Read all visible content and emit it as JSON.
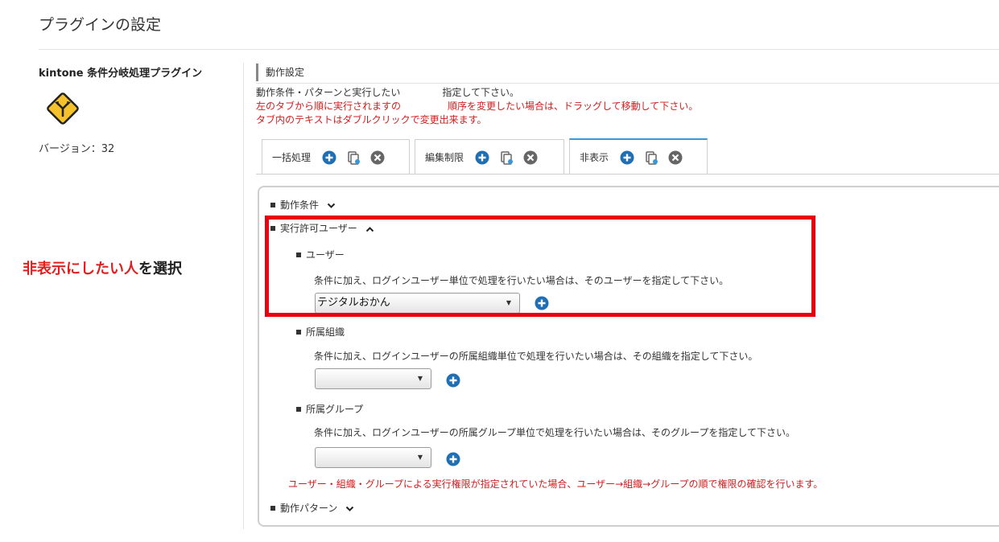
{
  "page": {
    "title": "プラグインの設定"
  },
  "plugin": {
    "name": "kintone 条件分岐処理プラグイン",
    "version": "バージョン：32",
    "icon": "diverge-road-sign-icon"
  },
  "annotation": {
    "highlight": "非表示にしたい人",
    "rest": "を選択"
  },
  "settings": {
    "heading": "動作設定",
    "desc_line1_a": "動作条件・パターンと実行したい",
    "desc_line1_b": "指定して下さい。",
    "desc_line2_a": "左のタブから順に実行されますの",
    "desc_line2_b": "順序を変更したい場合は、ドラッグして移動して下さい。",
    "desc_line3": "タブ内のテキストはダブルクリックで変更出来ます。"
  },
  "tabs": [
    {
      "label": "一括処理",
      "active": false
    },
    {
      "label": "編集制限",
      "active": false
    },
    {
      "label": "非表示",
      "active": true
    }
  ],
  "panel": {
    "condition": "動作条件",
    "permitted_users": "実行許可ユーザー",
    "user": {
      "heading": "ユーザー",
      "desc": "条件に加え、ログインユーザー単位で処理を行いたい場合は、そのユーザーを指定して下さい。",
      "selected": "テジタルおかん"
    },
    "org": {
      "heading": "所属組織",
      "desc": "条件に加え、ログインユーザーの所属組織単位で処理を行いたい場合は、その組織を指定して下さい。",
      "selected": ""
    },
    "group": {
      "heading": "所属グループ",
      "desc": "条件に加え、ログインユーザーの所属グループ単位で処理を行いたい場合は、そのグループを指定して下さい。",
      "selected": ""
    },
    "note": "ユーザー・組織・グループによる実行権限が指定されていた場合、ユーザー→組織→グループの順で権限の確認を行います。",
    "pattern": "動作パターン"
  },
  "colors": {
    "accent_blue": "#1f6fb5",
    "alert_red": "#d21d1d",
    "highlight_box": "#e8000f",
    "tab_active": "#3498db",
    "sign_yellow": "#f5c22b"
  }
}
